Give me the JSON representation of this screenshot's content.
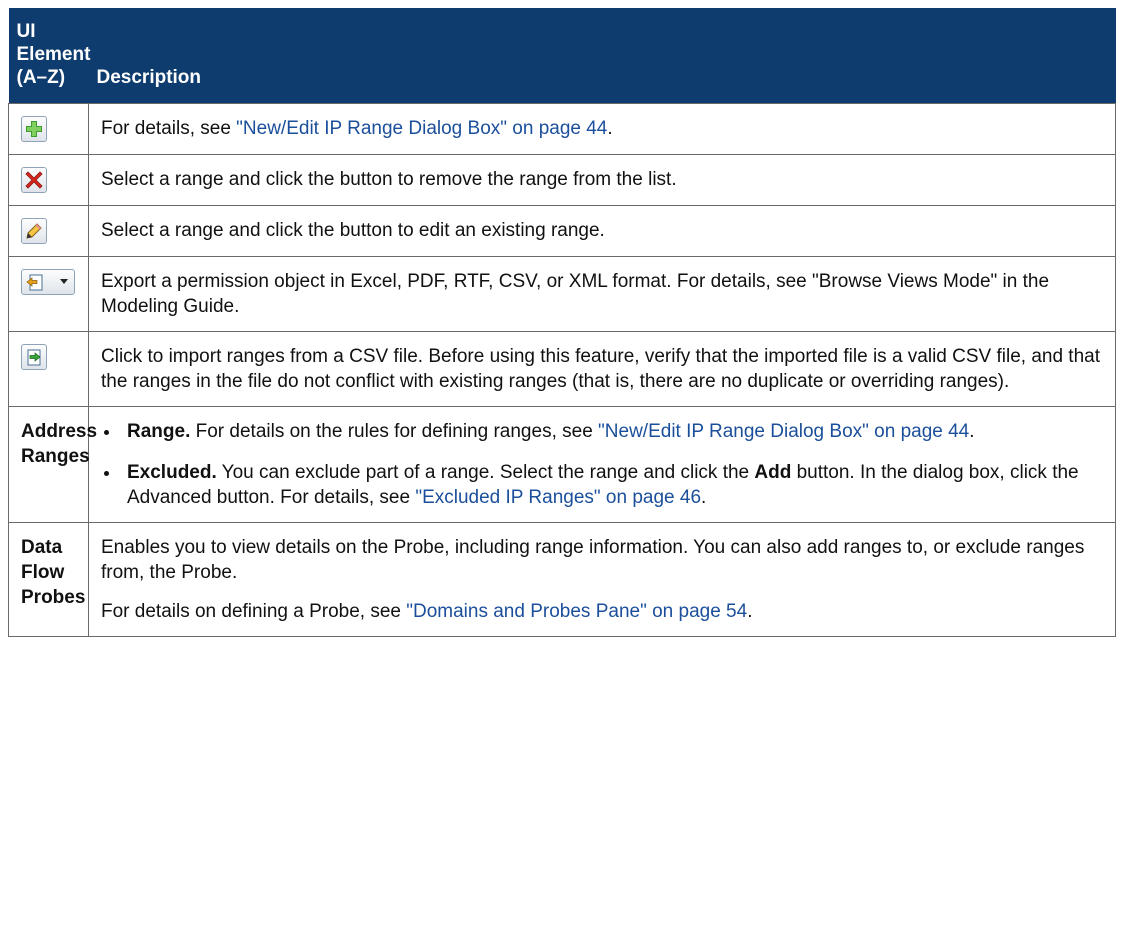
{
  "header": {
    "col1_line1": "UI",
    "col1_line2": "Element",
    "col1_line3": "(A–Z)",
    "col2": "Description"
  },
  "rows": {
    "new": {
      "icon": "add-green-plus-icon",
      "text": "For details, see ",
      "link": "\"New/Edit IP Range Dialog Box\" on page 44",
      "end": "."
    },
    "delete": {
      "icon": "delete-red-x-icon",
      "text": "Select a range and click the button to remove the range from the list."
    },
    "edit": {
      "icon": "edit-pencil-icon",
      "text": "Select a range and click the button to edit an existing range."
    },
    "export": {
      "icon": "export-icon",
      "text": "Export a permission object in Excel, PDF, RTF, CSV, or XML format. For details, see \"Browse Views Mode\" in the Modeling Guide."
    },
    "import": {
      "icon": "import-icon",
      "text": "Click to import ranges from a CSV file. Before using this feature, verify that the imported file is a valid CSV file, and that the ranges in the file do not conflict with existing ranges (that is, there are no duplicate or overriding ranges)."
    },
    "address": {
      "name_line1": "Address",
      "name_line2": "Ranges",
      "range_bold": "Range.",
      "range_text": " For details on the rules for defining ranges, see ",
      "range_link": "\"New/Edit IP Range Dialog Box\" on page 44",
      "range_end": ".",
      "excluded_bold": "Excluded.",
      "excluded_text1": " You can exclude part of a range. Select the range and click the ",
      "excluded_add": "Add",
      "excluded_text2": " button. In the dialog box, click the Advanced button. For details, see ",
      "excluded_link": "\"Excluded IP Ranges\" on page 46",
      "excluded_end": "."
    },
    "probes": {
      "name_line1": "Data",
      "name_line2": "Flow",
      "name_line3": "Probes",
      "para1": "Enables you to view details on the Probe, including range information. You can also add ranges to, or exclude ranges from, the Probe.",
      "para2_text": "For details on defining a Probe, see ",
      "para2_link": "\"Domains and Probes Pane\" on page 54",
      "para2_end": "."
    }
  }
}
